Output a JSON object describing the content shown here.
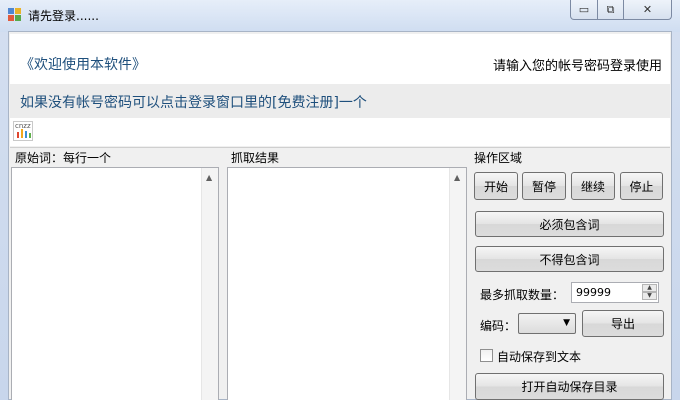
{
  "window": {
    "title": "请先登录......",
    "controls": {
      "minimize": "▭",
      "restore": "⧉",
      "close": "✕"
    }
  },
  "header": {
    "welcome": "《欢迎使用本软件》",
    "login_hint": "请输入您的帐号密码登录使用",
    "notice": "如果没有帐号密码可以点击登录窗口里的[免费注册]一个",
    "logo_text": "cnzz"
  },
  "source_panel": {
    "label": "原始词：每行一个",
    "content": ""
  },
  "result_panel": {
    "label": "抓取结果",
    "content": ""
  },
  "operations": {
    "label": "操作区域",
    "buttons": {
      "start": "开始",
      "pause": "暂停",
      "resume": "继续",
      "stop": "停止",
      "must_include": "必须包含词",
      "must_exclude": "不得包含词",
      "export": "导出",
      "open_dir": "打开自动保存目录"
    },
    "max_count_label": "最多抓取数量：",
    "max_count_value": "99999",
    "encoding_label": "编码：",
    "encoding_value": "",
    "autosave_label": "自动保存到文本",
    "autosave_checked": false
  },
  "colors": {
    "accent_text": "#1e4f7c",
    "logo_bars": [
      "#e0472f",
      "#f2a81d",
      "#3c8fd6",
      "#5fb04a"
    ]
  }
}
